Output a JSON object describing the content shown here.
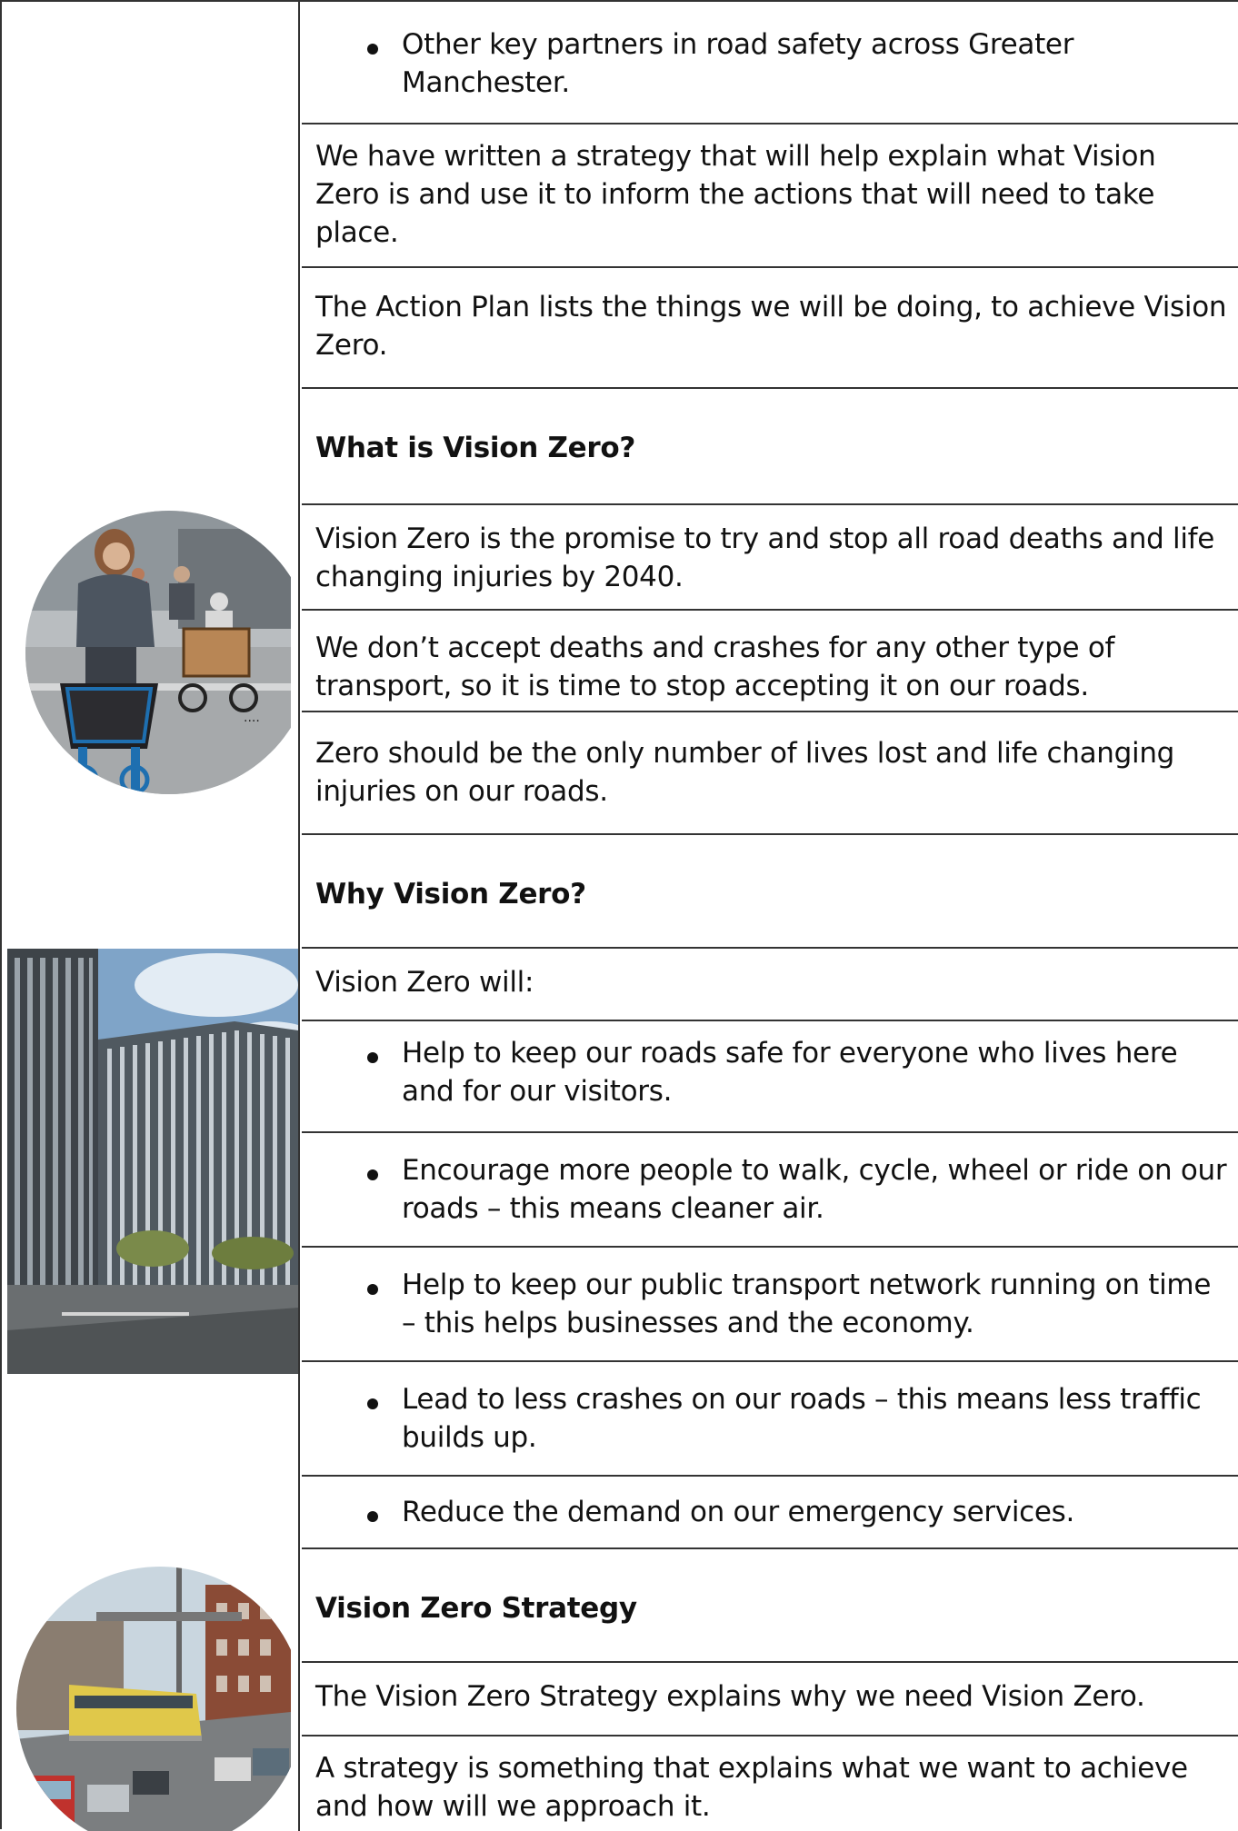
{
  "rows": [
    {
      "text": "Other key partners in road safety across Greater Manchester.",
      "style": "bullet"
    },
    {
      "text": "We have written a strategy that will help explain what Vision Zero is and use it to inform the actions that will need to take place.",
      "style": "normal"
    },
    {
      "text": "The Action Plan lists the things we will be doing, to achieve Vision Zero.",
      "style": "normal"
    },
    {
      "text": "What is Vision Zero?",
      "style": "heading"
    },
    {
      "text": "Vision Zero is the promise to try and stop all road deaths and life changing injuries by 2040.",
      "style": "normal"
    },
    {
      "text": "We don’t accept deaths and crashes for any other type of transport, so it is time to stop accepting it on our roads.",
      "style": "normal"
    },
    {
      "text": "Zero should be the only number of lives lost and life changing injuries on our roads.",
      "style": "normal"
    },
    {
      "text": "Why Vision Zero?",
      "style": "heading"
    },
    {
      "text": "Vision Zero will:",
      "style": "normal"
    },
    {
      "text": "Help to keep our roads safe for everyone who lives here and for our visitors.",
      "style": "bullet"
    },
    {
      "text": "Encourage more people to walk, cycle, wheel or ride on our roads – this means cleaner air.",
      "style": "bullet"
    },
    {
      "text": "Help to keep our public transport network running on time – this helps businesses and the economy.",
      "style": "bullet"
    },
    {
      "text": "Lead to less crashes on our roads – this means less traffic builds up.",
      "style": "bullet"
    },
    {
      "text": "Reduce the demand on our emergency services.",
      "style": "bullet"
    },
    {
      "text": "Vision Zero Strategy",
      "style": "heading"
    },
    {
      "text": "The Vision Zero Strategy explains why we need Vision Zero.",
      "style": "normal"
    },
    {
      "text": "A strategy is something that explains what we want to achieve and how will we approach it.",
      "style": "normal"
    }
  ],
  "images": {
    "cyclists": "photo-cyclists-circle",
    "buildings": "photo-city-buildings",
    "tram": "photo-tram-street-circle"
  }
}
